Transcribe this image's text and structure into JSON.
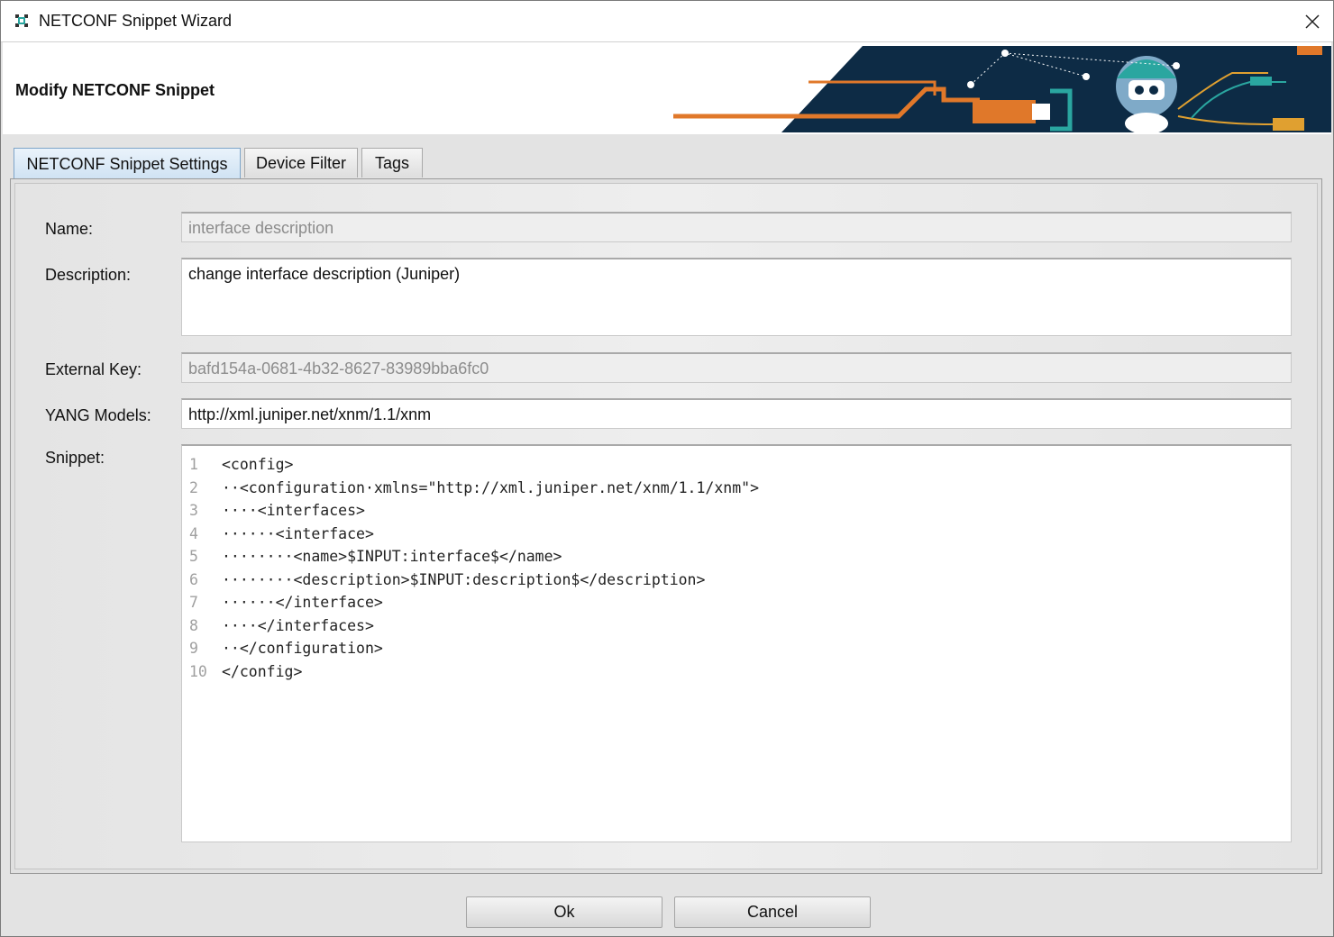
{
  "window": {
    "title": "NETCONF Snippet Wizard"
  },
  "header": {
    "title": "Modify NETCONF Snippet"
  },
  "tabs": [
    {
      "label": "NETCONF Snippet Settings",
      "active": true
    },
    {
      "label": "Device Filter",
      "active": false
    },
    {
      "label": "Tags",
      "active": false
    }
  ],
  "form": {
    "name": {
      "label": "Name:",
      "value": "interface description",
      "enabled": false
    },
    "description": {
      "label": "Description:",
      "value": "change interface description (Juniper)"
    },
    "external_key": {
      "label": "External Key:",
      "value": "bafd154a-0681-4b32-8627-83989bba6fc0",
      "enabled": false
    },
    "yang_models": {
      "label": "YANG Models:",
      "value": "http://xml.juniper.net/xnm/1.1/xnm"
    },
    "snippet": {
      "label": "Snippet:",
      "lines": [
        {
          "no": "1",
          "text": "<config>"
        },
        {
          "no": "2",
          "text": "··<configuration·xmlns=\"http://xml.juniper.net/xnm/1.1/xnm\">"
        },
        {
          "no": "3",
          "text": "····<interfaces>"
        },
        {
          "no": "4",
          "text": "······<interface>"
        },
        {
          "no": "5",
          "text": "········<name>$INPUT:interface$</name>"
        },
        {
          "no": "6",
          "text": "········<description>$INPUT:description$</description>"
        },
        {
          "no": "7",
          "text": "······</interface>"
        },
        {
          "no": "8",
          "text": "····</interfaces>"
        },
        {
          "no": "9",
          "text": "··</configuration>"
        },
        {
          "no": "10",
          "text": "</config>"
        }
      ]
    }
  },
  "buttons": {
    "ok": "Ok",
    "cancel": "Cancel"
  },
  "colors": {
    "banner_navy": "#0d2b45",
    "banner_orange": "#e0782a",
    "accent_teal": "#2aa6a0",
    "tab_active": "#cfe2f3"
  }
}
